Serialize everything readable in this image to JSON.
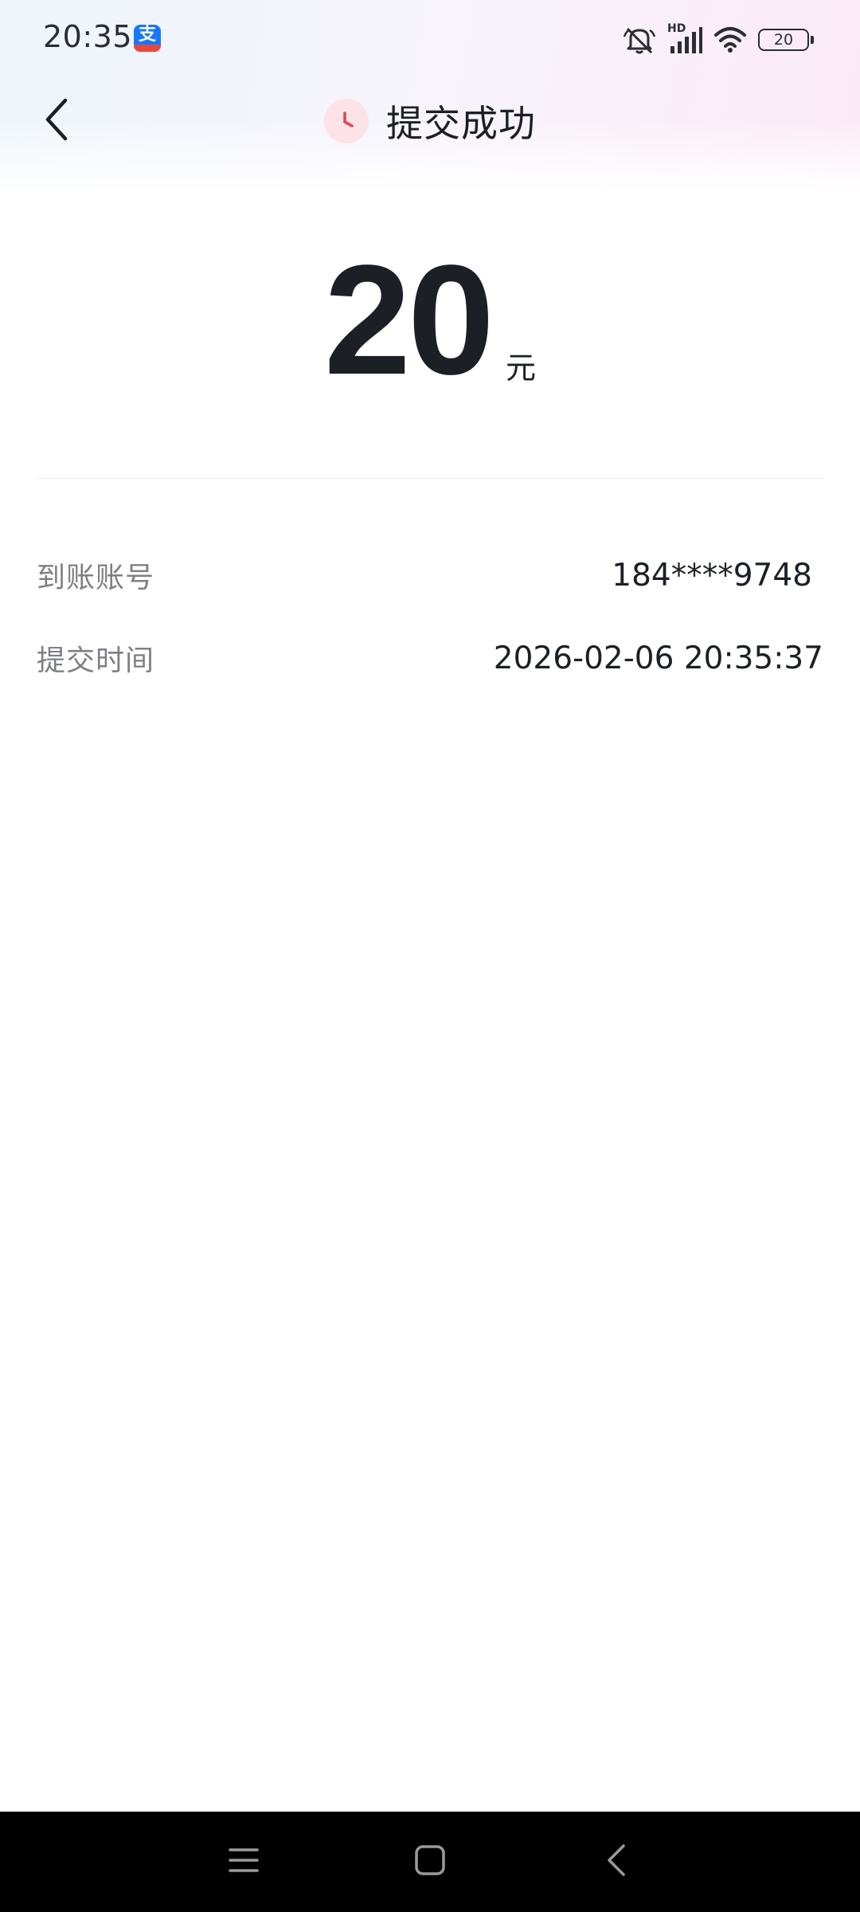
{
  "status_bar": {
    "time": "20:35",
    "app_badge": "支",
    "network_label": "HD",
    "battery_level": "20"
  },
  "header": {
    "title": "提交成功"
  },
  "amount": {
    "value": "20",
    "unit": "元"
  },
  "details": [
    {
      "label": "到账账号",
      "value": "184****9748"
    },
    {
      "label": "提交时间",
      "value": "2026-02-06 20:35:37"
    }
  ],
  "colors": {
    "accent_red": "#e0454f",
    "clock_bg": "#fbe3e8",
    "text_primary": "#1c1f26",
    "text_secondary": "#7d7f85"
  },
  "icons": {
    "back": "chevron-left-icon",
    "status": "clock-icon",
    "nav_menu": "menu-icon",
    "nav_home": "home-icon",
    "nav_back": "back-icon"
  }
}
